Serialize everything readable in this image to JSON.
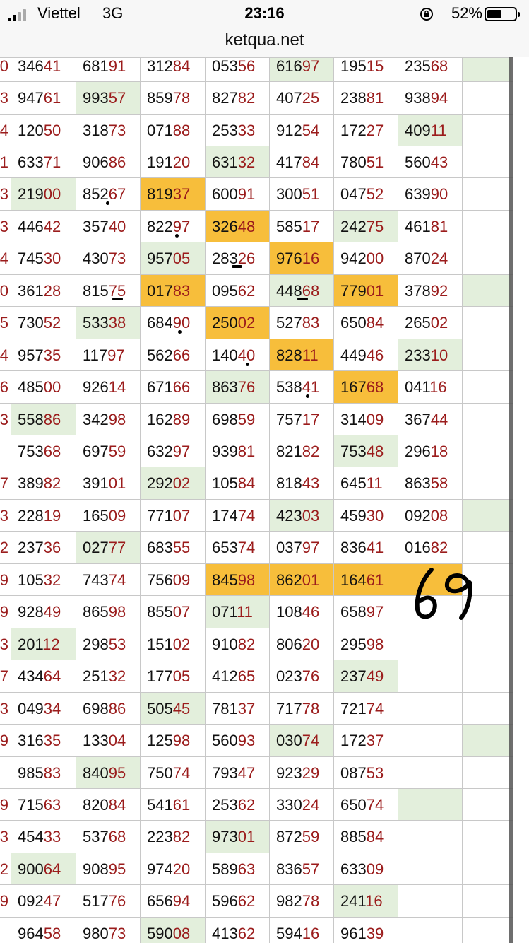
{
  "status_bar": {
    "carrier": "Viettel",
    "network": "3G",
    "time": "23:16",
    "battery_percent": "52%",
    "battery_level": 0.52
  },
  "browser": {
    "url": "ketqua.net"
  },
  "colors": {
    "green_cell": "#e3efdc",
    "orange_cell": "#f7be3b",
    "tail_digits": "#9b1c1c"
  },
  "handwritten_note": "69",
  "rows": [
    {
      "stub": "0",
      "cells": [
        "34641",
        "68191",
        "31284",
        "05356",
        "61697",
        "19515",
        "23568",
        ""
      ],
      "green": [
        4,
        7
      ],
      "orange": []
    },
    {
      "stub": "3",
      "cells": [
        "94761",
        "99357",
        "85978",
        "82782",
        "40725",
        "23881",
        "93894",
        ""
      ],
      "green": [
        1
      ],
      "orange": []
    },
    {
      "stub": "4",
      "cells": [
        "12050",
        "31873",
        "07188",
        "25333",
        "91254",
        "17227",
        "40911",
        ""
      ],
      "green": [
        6
      ],
      "orange": []
    },
    {
      "stub": "1",
      "cells": [
        "63371",
        "90686",
        "19120",
        "63132",
        "41784",
        "78051",
        "56043",
        ""
      ],
      "green": [
        3
      ],
      "orange": []
    },
    {
      "stub": "3",
      "cells": [
        "21900",
        "85267",
        "81937",
        "60091",
        "30051",
        "04752",
        "63990",
        ""
      ],
      "green": [
        0
      ],
      "orange": [
        2
      ]
    },
    {
      "stub": "3",
      "cells": [
        "44642",
        "35740",
        "82297",
        "32648",
        "58517",
        "24275",
        "46181",
        ""
      ],
      "green": [
        5
      ],
      "orange": [
        3
      ]
    },
    {
      "stub": "4",
      "cells": [
        "74530",
        "43073",
        "95705",
        "28326",
        "97616",
        "94200",
        "87024",
        ""
      ],
      "green": [
        2
      ],
      "orange": [
        4
      ]
    },
    {
      "stub": "0",
      "cells": [
        "36128",
        "81575",
        "01783",
        "09562",
        "44868",
        "77901",
        "37892",
        ""
      ],
      "green": [
        4,
        7
      ],
      "orange": [
        2,
        5
      ]
    },
    {
      "stub": "5",
      "cells": [
        "73052",
        "53338",
        "68490",
        "25002",
        "52783",
        "65084",
        "26502",
        ""
      ],
      "green": [
        1
      ],
      "orange": [
        3
      ]
    },
    {
      "stub": "4",
      "cells": [
        "95735",
        "11797",
        "56266",
        "14040",
        "82811",
        "44946",
        "23310",
        ""
      ],
      "green": [
        6
      ],
      "orange": [
        4
      ]
    },
    {
      "stub": "6",
      "cells": [
        "48500",
        "92614",
        "67166",
        "86376",
        "53841",
        "16768",
        "04116",
        ""
      ],
      "green": [
        3
      ],
      "orange": [
        5
      ]
    },
    {
      "stub": "3",
      "cells": [
        "55886",
        "34298",
        "16289",
        "69859",
        "75717",
        "31409",
        "36744",
        ""
      ],
      "green": [
        0
      ],
      "orange": []
    },
    {
      "stub": "",
      "cells": [
        "75368",
        "69759",
        "63297",
        "93981",
        "82182",
        "75348",
        "29618",
        ""
      ],
      "green": [
        5
      ],
      "orange": []
    },
    {
      "stub": "7",
      "cells": [
        "38982",
        "39101",
        "29202",
        "10584",
        "81843",
        "64511",
        "86358",
        ""
      ],
      "green": [
        2
      ],
      "orange": []
    },
    {
      "stub": "3",
      "cells": [
        "22819",
        "16509",
        "77107",
        "17474",
        "42303",
        "45930",
        "09208",
        ""
      ],
      "green": [
        4,
        7
      ],
      "orange": []
    },
    {
      "stub": "2",
      "cells": [
        "23736",
        "02777",
        "68355",
        "65374",
        "03797",
        "83641",
        "01682",
        ""
      ],
      "green": [
        1
      ],
      "orange": []
    },
    {
      "stub": "9",
      "cells": [
        "10532",
        "74374",
        "75609",
        "84598",
        "86201",
        "16461",
        "",
        ""
      ],
      "green": [],
      "orange": [
        3,
        4,
        5,
        6
      ]
    },
    {
      "stub": "9",
      "cells": [
        "92849",
        "86598",
        "85507",
        "07111",
        "10846",
        "65897",
        "",
        ""
      ],
      "green": [
        3
      ],
      "orange": []
    },
    {
      "stub": "3",
      "cells": [
        "20112",
        "29853",
        "15102",
        "91082",
        "80620",
        "29598",
        "",
        ""
      ],
      "green": [
        0
      ],
      "orange": []
    },
    {
      "stub": "7",
      "cells": [
        "43464",
        "25132",
        "17705",
        "41265",
        "02376",
        "23749",
        "",
        ""
      ],
      "green": [
        5
      ],
      "orange": []
    },
    {
      "stub": "3",
      "cells": [
        "04934",
        "69886",
        "50545",
        "78137",
        "71778",
        "72174",
        "",
        ""
      ],
      "green": [
        2
      ],
      "orange": []
    },
    {
      "stub": "9",
      "cells": [
        "31635",
        "13304",
        "12598",
        "56093",
        "03074",
        "17237",
        "",
        ""
      ],
      "green": [
        4,
        7
      ],
      "orange": []
    },
    {
      "stub": "",
      "cells": [
        "98583",
        "84095",
        "75074",
        "79347",
        "92329",
        "08753",
        "",
        ""
      ],
      "green": [
        1
      ],
      "orange": []
    },
    {
      "stub": "9",
      "cells": [
        "71563",
        "82084",
        "54161",
        "25362",
        "33024",
        "65074",
        "",
        ""
      ],
      "green": [
        6
      ],
      "orange": []
    },
    {
      "stub": "3",
      "cells": [
        "45433",
        "53768",
        "22382",
        "97301",
        "87259",
        "88584",
        "",
        ""
      ],
      "green": [
        3
      ],
      "orange": []
    },
    {
      "stub": "2",
      "cells": [
        "90064",
        "90895",
        "97420",
        "58963",
        "83657",
        "63309",
        "",
        ""
      ],
      "green": [
        0
      ],
      "orange": []
    },
    {
      "stub": "9",
      "cells": [
        "09247",
        "51776",
        "65694",
        "59662",
        "98278",
        "24116",
        "",
        ""
      ],
      "green": [
        5
      ],
      "orange": []
    },
    {
      "stub": "",
      "cells": [
        "96458",
        "98073",
        "59008",
        "41362",
        "59416",
        "96139",
        "",
        ""
      ],
      "green": [
        2
      ],
      "orange": []
    }
  ]
}
